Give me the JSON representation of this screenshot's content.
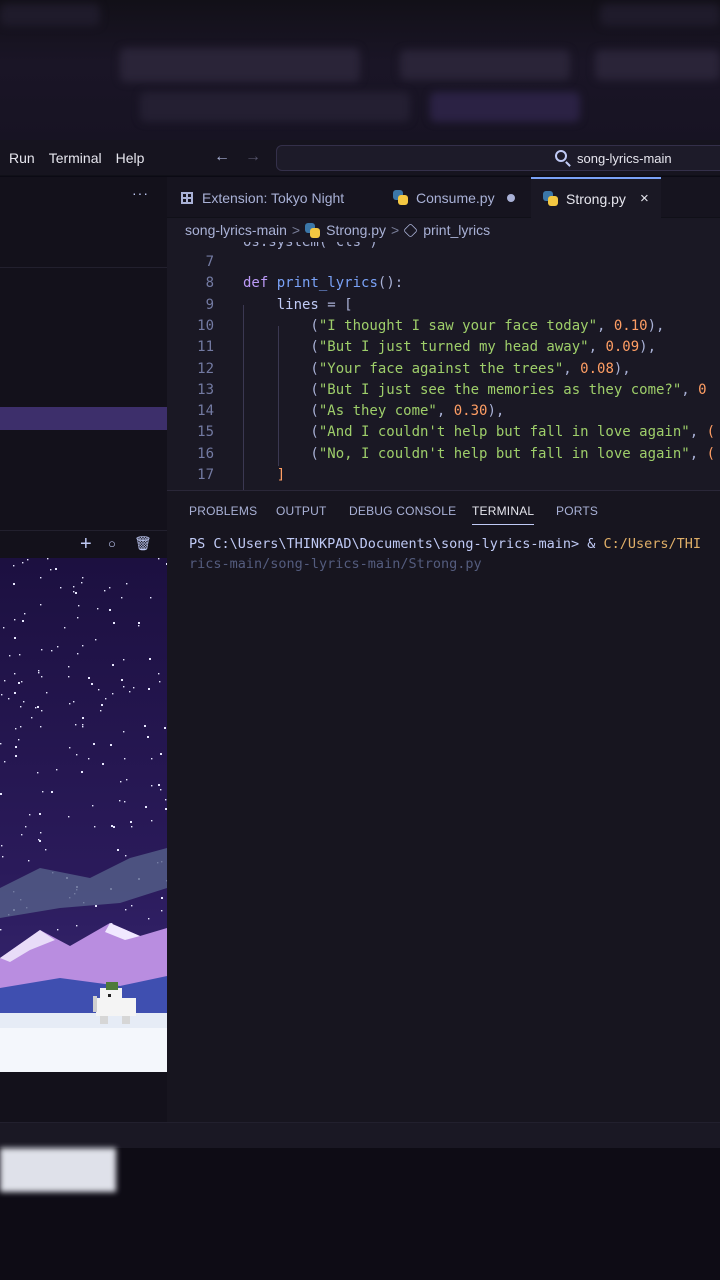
{
  "menu": {
    "items": [
      "Run",
      "Terminal",
      "Help"
    ],
    "back_icon": "arrow-left-icon",
    "forward_icon": "arrow-right-icon",
    "search_text": "song-lyrics-main"
  },
  "sidebar": {
    "more_icon": "ellipsis-icon",
    "more_label": "···",
    "panel_actions": [
      "plus-icon",
      "circle-icon",
      "trash-icon"
    ],
    "panel_action_glyphs": [
      "+",
      "○",
      "🗑"
    ]
  },
  "tabs": [
    {
      "label": "Extension: Tokyo Night",
      "icon": "extension-icon",
      "active": false
    },
    {
      "label": "Consume.py",
      "icon": "python-icon",
      "active": false,
      "dirty": true
    },
    {
      "label": "Strong.py",
      "icon": "python-icon",
      "active": true,
      "close": "×"
    }
  ],
  "breadcrumb": {
    "folder": "song-lyrics-main",
    "file": "Strong.py",
    "symbol": "print_lyrics",
    "sep": ">"
  },
  "code": {
    "partial_top": "os.system('cls')",
    "lines": [
      {
        "n": "7"
      },
      {
        "n": "8",
        "kw": "def",
        "fn": "print_lyrics",
        "rest": "():"
      },
      {
        "n": "9",
        "var": "lines",
        "rest": " = ["
      },
      {
        "n": "10",
        "str": "\"I thought I saw your face today\"",
        "num": "0.10",
        "tail": "),"
      },
      {
        "n": "11",
        "str": "\"But I just turned my head away\"",
        "num": "0.09",
        "tail": "),"
      },
      {
        "n": "12",
        "str": "\"Your face against the trees\"",
        "num": "0.08",
        "tail": "),"
      },
      {
        "n": "13",
        "str": "\"But I just see the memories as they come?\"",
        "num": "0",
        "tail": ""
      },
      {
        "n": "14",
        "str": "\"As they come\"",
        "num": "0.30",
        "tail": "),"
      },
      {
        "n": "15",
        "str": "\"And I couldn't help but fall in love again\"",
        "num": "(",
        "tail": ""
      },
      {
        "n": "16",
        "str": "\"No, I couldn't help but fall in love again\"",
        "num": "(",
        "tail": ""
      },
      {
        "n": "17",
        "var": "",
        "rest": "]"
      }
    ]
  },
  "panel": {
    "tabs": [
      "PROBLEMS",
      "OUTPUT",
      "DEBUG CONSOLE",
      "TERMINAL",
      "PORTS"
    ],
    "active_tab": "TERMINAL",
    "terminal_prompt": "PS C:\\Users\\THINKPAD\\Documents\\song-lyrics-main> & ",
    "terminal_cmd": "C:/Users/THI",
    "terminal_cont": "rics-main/song-lyrics-main/Strong.py"
  },
  "colors": {
    "accent": "#7aa2f7",
    "keyword": "#bb9af7",
    "string": "#9ece6a",
    "number": "#ff9e64",
    "selection": "#3d2f6b"
  }
}
